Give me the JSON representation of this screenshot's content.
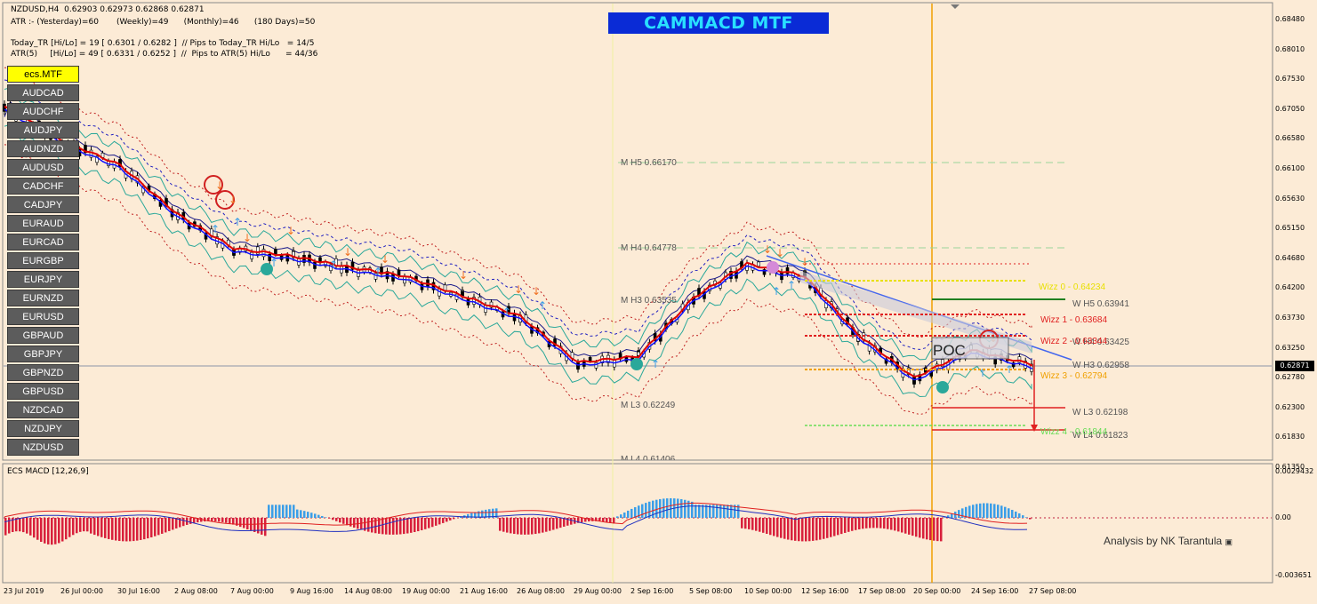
{
  "header": {
    "symbol_line": "NZDUSD,H4  0.62903 0.62973 0.62868 0.62871",
    "atr_line": "ATR :- (Yesterday)=60       (Weekly)=49      (Monthly)=46      (180 Days)=50",
    "today_tr": "Today_TR [Hi/Lo] = 19 [ 0.6301 / 0.6282 ]  // Pips to Today_TR Hi/Lo   = 14/5",
    "atr5": "ATR(5)     [Hi/Lo] = 49 [ 0.6331 / 0.6252 ]  //  Pips to ATR(5) Hi/Lo      = 44/36"
  },
  "banner": "CAMMACD MTF",
  "pairs": [
    "ecs.MTF",
    "AUDCAD",
    "AUDCHF",
    "AUDJPY",
    "AUDNZD",
    "AUDUSD",
    "CADCHF",
    "CADJPY",
    "EURAUD",
    "EURCAD",
    "EURGBP",
    "EURJPY",
    "EURNZD",
    "EURUSD",
    "GBPAUD",
    "GBPJPY",
    "GBPNZD",
    "GBPUSD",
    "NZDCAD",
    "NZDJPY",
    "NZDUSD"
  ],
  "price_axis": [
    "0.68480",
    "0.68010",
    "0.67530",
    "0.67050",
    "0.66580",
    "0.66100",
    "0.65630",
    "0.65150",
    "0.64680",
    "0.64200",
    "0.63730",
    "0.63250",
    "0.62780",
    "0.62300",
    "0.61830",
    "0.61350"
  ],
  "current_price": "0.62871",
  "time_axis": [
    "23 Jul 2019",
    "26 Jul 00:00",
    "30 Jul 16:00",
    "2 Aug 08:00",
    "7 Aug 00:00",
    "9 Aug 16:00",
    "14 Aug 08:00",
    "19 Aug 00:00",
    "21 Aug 16:00",
    "26 Aug 08:00",
    "29 Aug 00:00",
    "2 Sep 16:00",
    "5 Sep 08:00",
    "10 Sep 00:00",
    "12 Sep 16:00",
    "17 Sep 08:00",
    "20 Sep 00:00",
    "24 Sep 16:00",
    "27 Sep 08:00"
  ],
  "monthly_levels": [
    "M  H5 0.66170",
    "M  H4 0.64778",
    "M  H3 0.63535",
    "M  L3 0.62249",
    "M  L4 0.61406"
  ],
  "weekly_levels": [
    "W  H5 0.63941",
    "W  H4 0.63425",
    "W  H3 0.62958",
    "W  L3 0.62198",
    "W  L4 0.61823"
  ],
  "wizz_levels": [
    {
      "label": "Wizz 0 - 0.64234",
      "color": "#e8e000"
    },
    {
      "label": "Wizz 1 - 0.63684",
      "color": "#e02020"
    },
    {
      "label": "Wizz 2 - 0.63344",
      "color": "#e02020"
    },
    {
      "label": "Wizz 3 - 0.62794",
      "color": "#f0a000"
    },
    {
      "label": "Wizz 4 - 0.61844",
      "color": "#66dd55"
    }
  ],
  "poc_label": "POC",
  "macd_label": "ECS MACD [12,26,9]",
  "macd_axis": [
    "0.0029432",
    "0.00",
    "-0.003651"
  ],
  "analysis": "Analysis by NK Tarantula",
  "colors": {
    "background": "#fcebd6",
    "ma_red": "#e00000",
    "ma_blue": "#1010ff",
    "bb": "#2aa89a",
    "vline_orange": "#f0a000",
    "macd_pos": "#3a9ee8",
    "macd_neg": "#d8203c"
  },
  "chart_data": {
    "type": "line",
    "title": "CAMMACD MTF",
    "symbol": "NZDUSD,H4",
    "ylim": [
      0.6135,
      0.6848
    ],
    "x": [
      "23 Jul 2019",
      "26 Jul 00:00",
      "30 Jul 16:00",
      "2 Aug 08:00",
      "7 Aug 00:00",
      "9 Aug 16:00",
      "14 Aug 08:00",
      "19 Aug 00:00",
      "21 Aug 16:00",
      "26 Aug 08:00",
      "29 Aug 00:00",
      "2 Sep 16:00",
      "5 Sep 08:00",
      "10 Sep 00:00",
      "12 Sep 16:00",
      "17 Sep 08:00",
      "20 Sep 00:00",
      "24 Sep 16:00",
      "27 Sep 08:00"
    ],
    "series": [
      {
        "name": "close",
        "values": [
          0.6705,
          0.665,
          0.661,
          0.653,
          0.6475,
          0.6462,
          0.6445,
          0.643,
          0.6398,
          0.6365,
          0.629,
          0.63,
          0.6395,
          0.645,
          0.643,
          0.6335,
          0.6265,
          0.631,
          0.6287
        ]
      }
    ],
    "macd": {
      "ylim": [
        -0.003651,
        0.0029432
      ]
    }
  }
}
